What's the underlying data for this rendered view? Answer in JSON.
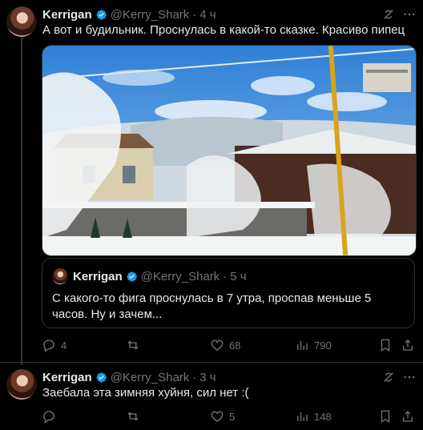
{
  "tweets": [
    {
      "author": "Kerrigan",
      "handle": "@Kerry_Shark",
      "dot": "·",
      "time": "4 ч",
      "text": "А вот и будильник. Проснулась в какой-то сказке. Красиво пипец",
      "quote": {
        "author": "Kerrigan",
        "handle": "@Kerry_Shark",
        "dot": "·",
        "time": "5 ч",
        "text": "С какого-то фига проснулась в 7 утра, проспав меньше 5 часов. Ну и зачем..."
      },
      "replies": "4",
      "retweets": "",
      "likes": "68",
      "views": "790"
    },
    {
      "author": "Kerrigan",
      "handle": "@Kerry_Shark",
      "dot": "·",
      "time": "3 ч",
      "text": "Заебала эта зимняя хуйня, сил нет :(",
      "replies": "",
      "retweets": "",
      "likes": "5",
      "views": "148"
    }
  ],
  "colors": {
    "background": "#000000",
    "text": "#e7e9ea",
    "secondary": "#71767b",
    "verified": "#1d9bf0",
    "border": "#2f3336"
  },
  "icons": [
    "verified-badge-icon",
    "grok-icon",
    "more-icon",
    "reply-icon",
    "retweet-icon",
    "like-icon",
    "views-icon",
    "bookmark-icon",
    "share-icon"
  ]
}
